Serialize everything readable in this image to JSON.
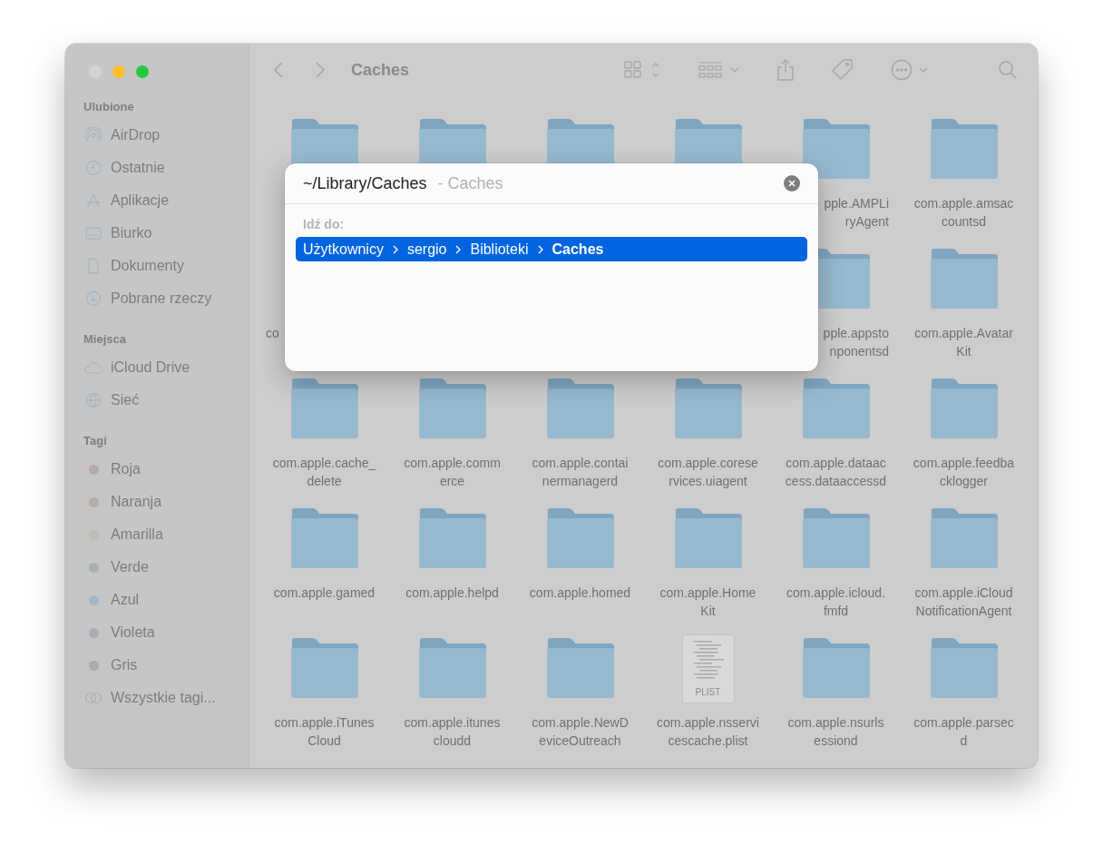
{
  "window": {
    "title": "Caches",
    "controls": [
      {
        "color": "#d3d3d3"
      },
      {
        "color": "#febc2e"
      },
      {
        "color": "#28c840"
      }
    ]
  },
  "sidebar": {
    "sections": [
      {
        "title": "Ulubione",
        "items": [
          {
            "kind": "airdrop",
            "label": "AirDrop"
          },
          {
            "kind": "recent",
            "label": "Ostatnie"
          },
          {
            "kind": "apps",
            "label": "Aplikacje"
          },
          {
            "kind": "desktop",
            "label": "Biurko"
          },
          {
            "kind": "document",
            "label": "Dokumenty"
          },
          {
            "kind": "download",
            "label": "Pobrane rzeczy"
          }
        ]
      },
      {
        "title": "Miejsca",
        "items": [
          {
            "kind": "cloud",
            "label": "iCloud Drive"
          },
          {
            "kind": "network",
            "label": "Sieć"
          }
        ]
      },
      {
        "title": "Tagi",
        "items": [
          {
            "kind": "tag",
            "label": "Roja",
            "color": "#b3a9a9"
          },
          {
            "kind": "tag",
            "label": "Naranja",
            "color": "#b4aca7"
          },
          {
            "kind": "tag",
            "label": "Amarilla",
            "color": "#bdbcb6"
          },
          {
            "kind": "tag",
            "label": "Verde",
            "color": "#a9b0ad"
          },
          {
            "kind": "tag",
            "label": "Azul",
            "color": "#a3b6c6"
          },
          {
            "kind": "tag",
            "label": "Violeta",
            "color": "#aeaab3"
          },
          {
            "kind": "tag",
            "label": "Gris",
            "color": "#ababad"
          },
          {
            "kind": "alltags",
            "label": "Wszystkie tagi..."
          }
        ]
      }
    ]
  },
  "files": [
    {
      "kind": "folder"
    },
    {
      "kind": "folder"
    },
    {
      "kind": "folder"
    },
    {
      "kind": "folder"
    },
    {
      "kind": "folder",
      "label": "pple.AMPLi\nryAgent",
      "clipped": true
    },
    {
      "kind": "folder",
      "label": "com.apple.amsac\ncountsd"
    },
    {
      "kind": "blank",
      "label": "co",
      "clipped": true
    },
    {
      "kind": "blank"
    },
    {
      "kind": "blank"
    },
    {
      "kind": "blank"
    },
    {
      "kind": "folder",
      "label": "pple.appsto\nnponentsd",
      "clipped": true
    },
    {
      "kind": "folder",
      "label": "com.apple.Avatar\nKit"
    },
    {
      "kind": "folder",
      "label": "com.apple.cache_\ndelete"
    },
    {
      "kind": "folder",
      "label": "com.apple.comm\nerce"
    },
    {
      "kind": "folder",
      "label": "com.apple.contai\nnermanagerd"
    },
    {
      "kind": "folder",
      "label": "com.apple.corese\nrvices.uiagent"
    },
    {
      "kind": "folder",
      "label": "com.apple.dataac\ncess.dataaccessd"
    },
    {
      "kind": "folder",
      "label": "com.apple.feedba\ncklogger"
    },
    {
      "kind": "folder",
      "label": "com.apple.gamed"
    },
    {
      "kind": "folder",
      "label": "com.apple.helpd"
    },
    {
      "kind": "folder",
      "label": "com.apple.homed"
    },
    {
      "kind": "folder",
      "label": "com.apple.Home\nKit"
    },
    {
      "kind": "folder",
      "label": "com.apple.icloud.\nfmfd"
    },
    {
      "kind": "folder",
      "label": "com.apple.iCloud\nNotificationAgent"
    },
    {
      "kind": "folder",
      "label": "com.apple.iTunes\nCloud"
    },
    {
      "kind": "folder",
      "label": "com.apple.itunes\ncloudd"
    },
    {
      "kind": "folder",
      "label": "com.apple.NewD\neviceOutreach"
    },
    {
      "kind": "plist",
      "badge": "PLIST",
      "label": "com.apple.nsservi\ncescache.plist"
    },
    {
      "kind": "folder",
      "label": "com.apple.nsurls\nessiond"
    },
    {
      "kind": "folder",
      "label": "com.apple.parsec\nd"
    }
  ],
  "goto_dialog": {
    "value": "~/Library/Caches",
    "suffix": "- Caches",
    "section": "Idź do:",
    "results": [
      {
        "selected": true,
        "path": [
          "Użytkownicy",
          "sergio",
          "Biblioteki",
          "Caches"
        ]
      }
    ]
  }
}
